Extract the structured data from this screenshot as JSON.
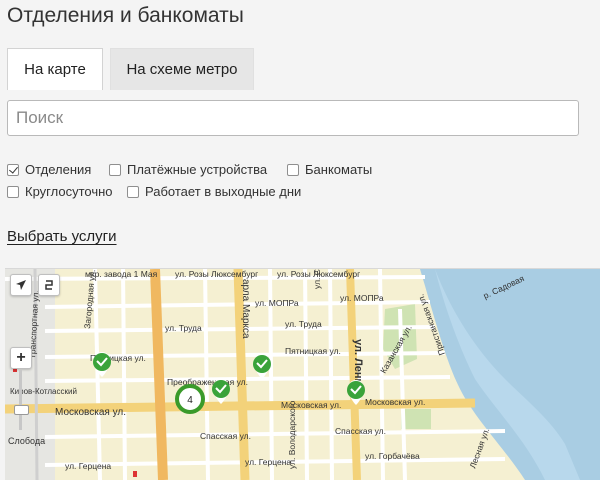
{
  "page": {
    "title": "Отделения и банкоматы"
  },
  "tabs": [
    {
      "label": "На карте",
      "active": true
    },
    {
      "label": "На схеме метро",
      "active": false
    }
  ],
  "search": {
    "placeholder": "Поиск",
    "value": ""
  },
  "filters": [
    {
      "label": "Отделения",
      "checked": true
    },
    {
      "label": "Платёжные устройства",
      "checked": false
    },
    {
      "label": "Банкоматы",
      "checked": false
    },
    {
      "label": "Круглосуточно",
      "checked": false
    },
    {
      "label": "Работает в выходные дни",
      "checked": false
    }
  ],
  "services_link": "Выбрать услуги",
  "map": {
    "cluster_count": "4",
    "streets": {
      "mkr1may": "мкр. завода 1 Мая",
      "rozy1": "ул. Розы Люксембург",
      "rozy2": "ул. Розы Люксембург",
      "mopra1": "ул. МОПРа",
      "mopra2": "ул. МОПРа",
      "truda1": "ул. Труда",
      "truda2": "ул. Труда",
      "pyatnitskaya1": "Пятницкая ул.",
      "pyatnitskaya2": "Пятницкая ул.",
      "preobrazhenskaya": "Преображенская ул.",
      "moskovskaya1": "Московская ул.",
      "moskovskaya2": "Московская ул.",
      "moskovskaya3": "Московская ул.",
      "spasskaya1": "Спасская ул.",
      "spasskaya2": "Спасская ул.",
      "gertsena1": "ул. Герцена",
      "gertsena2": "ул. Герцена",
      "gorbachyova": "ул. Горбачёва",
      "marksa": "арла Маркса",
      "lenina": "ул. Ленин",
      "svobody": "ул. Свободы",
      "volodarskogo": "ул. Володарского",
      "kazanskaya": "Казанская ул.",
      "pristanskaya": "Пристанская ул.",
      "zagorodnaya": "Загородная ул.",
      "transportnaya": "Транспортная ул.",
      "sadovaya": "р. Садовая",
      "kirov": "Киров-Котласский",
      "sloboda": "Слобода",
      "lesnaya": "Лесная ул."
    }
  }
}
